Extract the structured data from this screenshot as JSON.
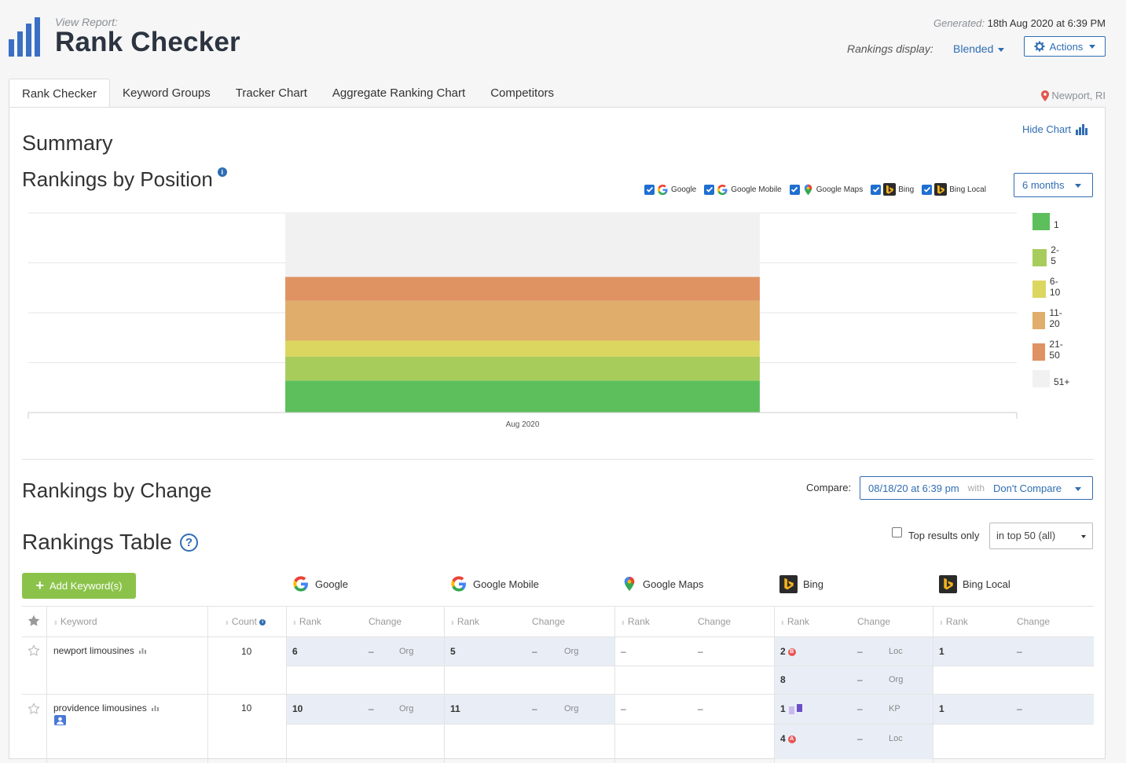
{
  "header": {
    "view_report_label": "View Report:",
    "title": "Rank Checker",
    "generated_label": "Generated:",
    "generated_value": "18th Aug 2020 at 6:39 PM",
    "rankings_display_label": "Rankings display:",
    "rankings_display_value": "Blended",
    "actions_label": "Actions"
  },
  "tabs": [
    {
      "label": "Rank Checker",
      "active": true
    },
    {
      "label": "Keyword Groups"
    },
    {
      "label": "Tracker Chart"
    },
    {
      "label": "Aggregate Ranking Chart"
    },
    {
      "label": "Competitors"
    }
  ],
  "location": "Newport, RI",
  "summary": {
    "title": "Summary",
    "hide_chart": "Hide Chart",
    "rankings_by_position": "Rankings by Position",
    "info_icon": "i",
    "engines": [
      {
        "label": "Google",
        "checked": true
      },
      {
        "label": "Google Mobile",
        "checked": true
      },
      {
        "label": "Google Maps",
        "checked": true
      },
      {
        "label": "Bing",
        "checked": true
      },
      {
        "label": "Bing Local",
        "checked": true
      }
    ],
    "period": "6 months"
  },
  "chart_data": {
    "type": "bar",
    "stacked": true,
    "categories": [
      "Aug 2020"
    ],
    "series": [
      {
        "name": "1",
        "color": "#5cbf5c",
        "values": [
          16
        ]
      },
      {
        "name": "2-5",
        "color": "#a7cc5c",
        "values": [
          12
        ]
      },
      {
        "name": "6-10",
        "color": "#dbd660",
        "values": [
          8
        ]
      },
      {
        "name": "11-20",
        "color": "#e0ad6a",
        "values": [
          20
        ]
      },
      {
        "name": "21-50",
        "color": "#df9262",
        "values": [
          12
        ]
      },
      {
        "name": "51+",
        "color": "#f1f1f1",
        "values": [
          32
        ]
      }
    ],
    "ylim": [
      0,
      100
    ],
    "grid": true,
    "legend": "right",
    "xlabel": "",
    "ylabel": "",
    "title": ""
  },
  "change": {
    "title": "Rankings by Change",
    "compare_label": "Compare:",
    "compare_date": "08/18/20 at 6:39 pm",
    "with_label": "with",
    "compare_with": "Don't Compare"
  },
  "table": {
    "title": "Rankings Table",
    "help_icon": "?",
    "top_results_label": "Top results only",
    "top_filter": "in top 50 (all)",
    "add_keyword": "Add Keyword(s)",
    "plus": "+",
    "engine_heads": [
      "Google",
      "Google Mobile",
      "Google Maps",
      "Bing",
      "Bing Local"
    ],
    "headers": {
      "keyword": "Keyword",
      "count": "Count",
      "rank": "Rank",
      "change": "Change"
    },
    "rows": [
      {
        "keyword": "newport limousines",
        "count": "10",
        "google": {
          "rank": "6",
          "change": "–",
          "type": "Org"
        },
        "google_mobile": {
          "rank": "5",
          "change": "–",
          "type": "Org"
        },
        "google_maps": {
          "rank": "–",
          "change": "–"
        },
        "bing": [
          {
            "rank": "2",
            "badge": "B",
            "change": "–",
            "type": "Loc"
          },
          {
            "rank": "8",
            "change": "–",
            "type": "Org"
          }
        ],
        "bing_local": {
          "rank": "1",
          "change": "–"
        }
      },
      {
        "keyword": "providence limousines",
        "count": "10",
        "google": {
          "rank": "10",
          "change": "–",
          "type": "Org"
        },
        "google_mobile": {
          "rank": "11",
          "change": "–",
          "type": "Org"
        },
        "google_maps": {
          "rank": "–",
          "change": "–"
        },
        "bing": [
          {
            "rank": "1",
            "change": "–",
            "type": "KP"
          },
          {
            "rank": "4",
            "badge": "A",
            "change": "–",
            "type": "Loc"
          }
        ],
        "bing_local": {
          "rank": "1",
          "change": "–"
        }
      }
    ]
  }
}
